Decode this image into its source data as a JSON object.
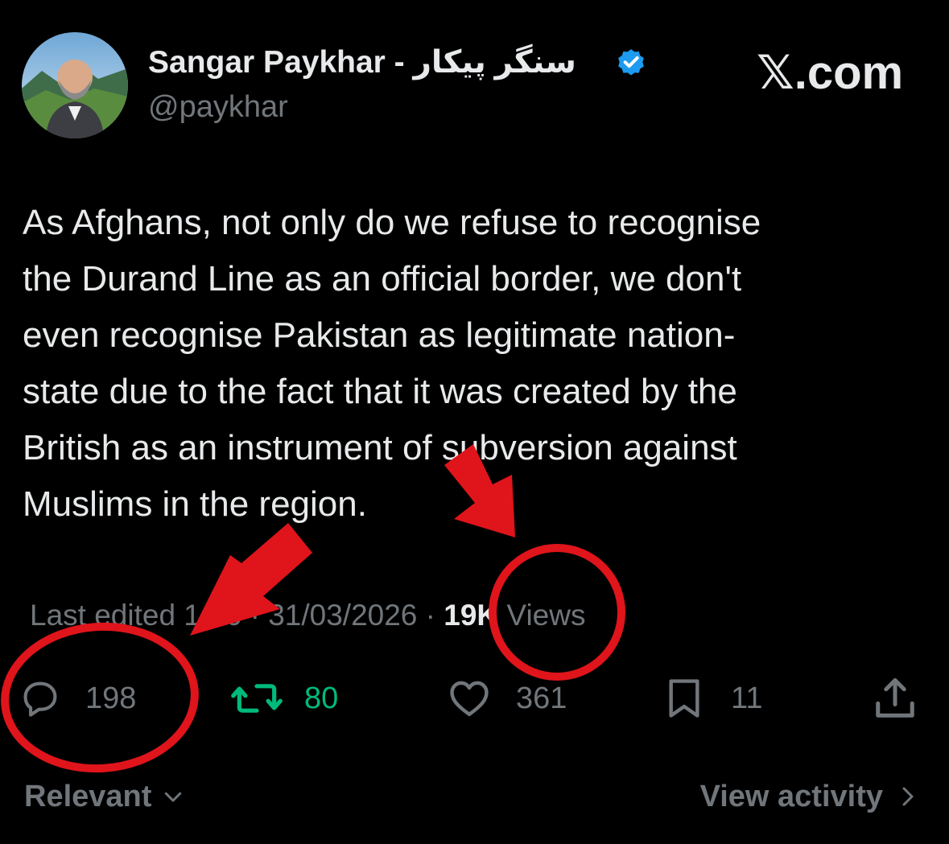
{
  "author": {
    "display_name": "Sangar Paykhar - سنگر پیکار",
    "handle": "@paykhar",
    "verified": true,
    "avatar_icon": "profile-photo"
  },
  "watermark": "𝕏.com",
  "tweet": {
    "lines": [
      "As Afghans, not only do we refuse to recognise",
      "the Durand Line as an official border, we don't",
      "even recognise Pakistan as legitimate nation-",
      "state due to the fact that it was created by the",
      "British as an instrument of subversion against",
      "Muslims in the region."
    ],
    "meta_prefix": "Last edited 1:16 · 31/03/2026 · ",
    "views_count": "19K",
    "views_label": " Views"
  },
  "actions": {
    "replies": "198",
    "retweets": "80",
    "likes": "361",
    "bookmarks": "11"
  },
  "footer": {
    "sort_label": "Relevant",
    "view_activity_label": "View activity"
  },
  "colors": {
    "background": "#000000",
    "text_primary": "#e7e9ea",
    "text_secondary": "#71767b",
    "retweet_green": "#00ba7c",
    "verified_blue": "#1d9bf0",
    "annotation_red": "#e0141b"
  }
}
